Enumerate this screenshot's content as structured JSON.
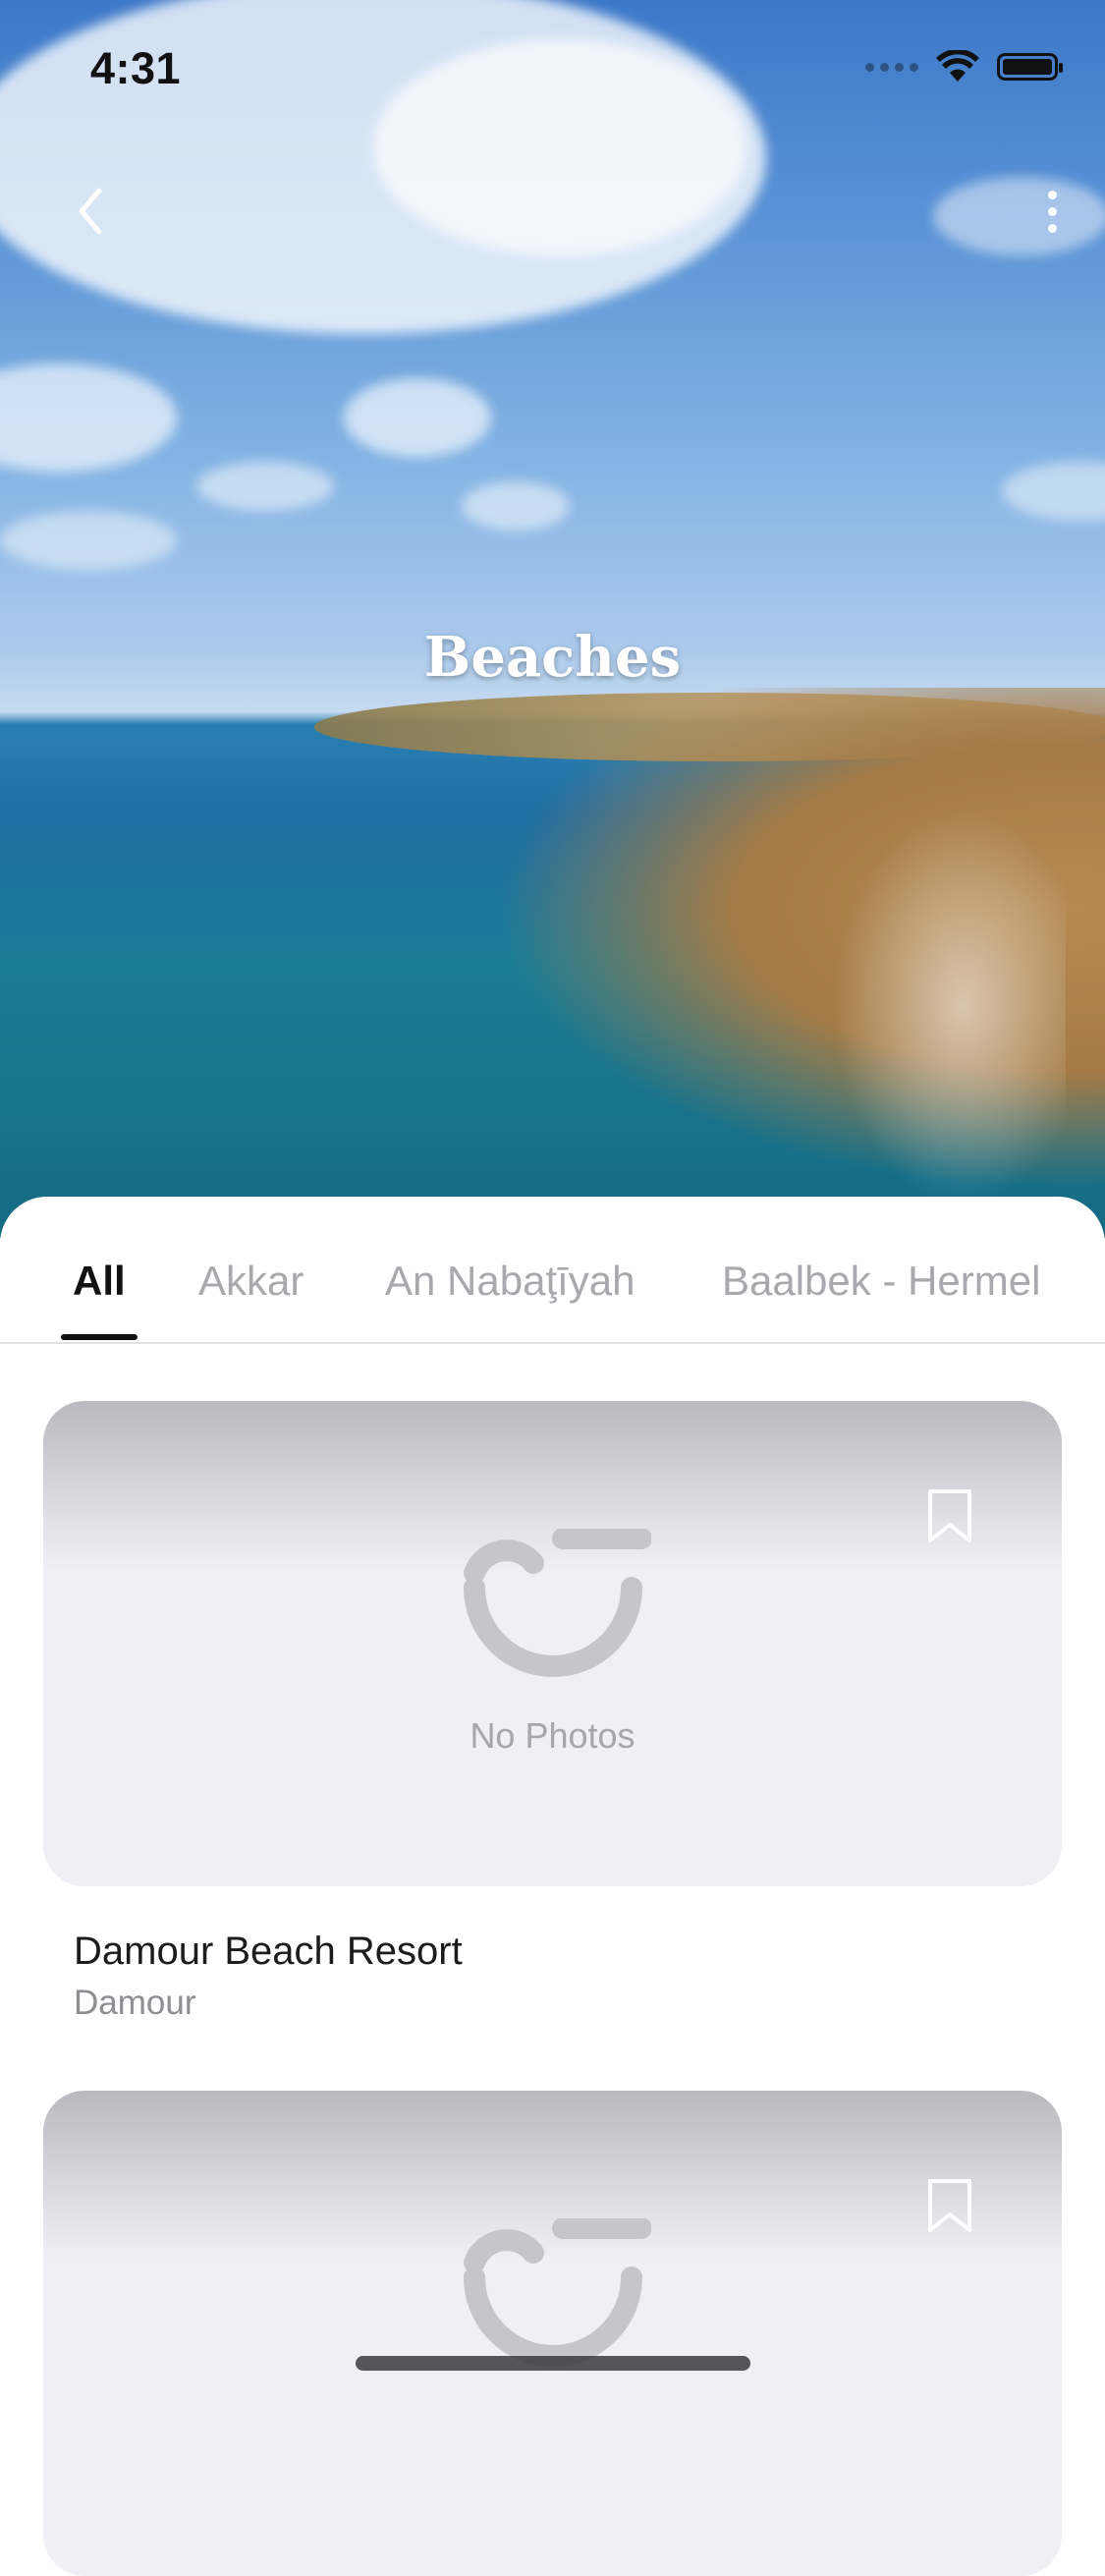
{
  "status_bar": {
    "time": "4:31"
  },
  "header": {
    "title": "Beaches"
  },
  "tabs": [
    {
      "label": "All",
      "active": true
    },
    {
      "label": "Akkar",
      "active": false
    },
    {
      "label": "An Nabaţīyah",
      "active": false
    },
    {
      "label": "Baalbek - Hermel",
      "active": false
    }
  ],
  "cards": [
    {
      "placeholder": "No Photos",
      "name": "Damour Beach Resort",
      "location": "Damour"
    },
    {
      "placeholder": "",
      "name": "",
      "location": ""
    }
  ],
  "icons": {
    "back": "chevron-left-icon",
    "more": "more-vertical-icon",
    "bookmark": "bookmark-icon",
    "no_photo": "no-photo-icon"
  },
  "colors": {
    "accent": "#111111",
    "inactive_tab": "#a9a9ad",
    "card_bg": "#f0f0f4"
  }
}
